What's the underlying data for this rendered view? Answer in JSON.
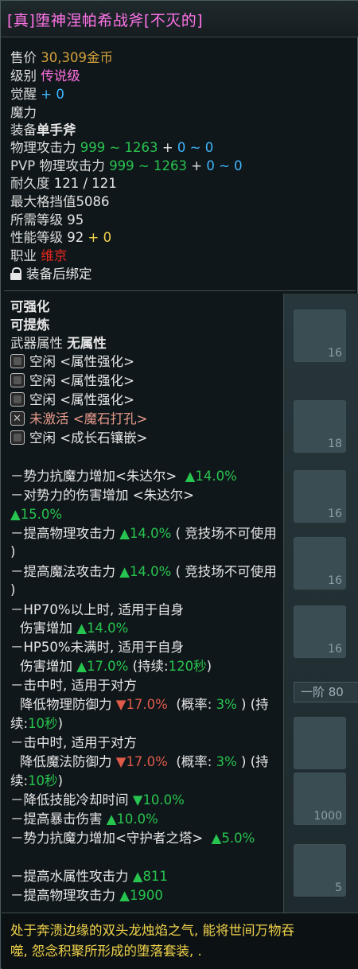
{
  "title": "[真]堕神涅帕希战斧[不灭的]",
  "header": {
    "price_label": "售价",
    "price_value": "30,309金币",
    "grade_label": "级别",
    "grade_value": "传说级",
    "awaken_label": "觉醒",
    "awaken_value": "+ 0",
    "magic_label": "魔力",
    "equip_label": "装备",
    "equip_value": "单手斧",
    "patk_label": "物理攻击力",
    "patk_range": "999 ~ 1263",
    "patk_plus": "+",
    "patk_bonus": "0 ~ 0",
    "pvp_label": "PVP 物理攻击力",
    "pvp_range": "999 ~ 1263",
    "pvp_plus": "+",
    "pvp_bonus": "0 ~ 0",
    "durability_label": "耐久度",
    "durability_value": "121 / 121",
    "block_label": "最大格挡值",
    "block_value": "5086",
    "req_level_label": "所需等级",
    "req_level_value": "95",
    "perf_level_label": "性能等级",
    "perf_level_value": "92",
    "perf_level_bonus": "+ 0",
    "job_label": "职业",
    "job_value": "维京",
    "bind_text": "装备后绑定"
  },
  "enhance": {
    "enhanceable": "可强化",
    "refinable": "可提炼",
    "weapon_attr_label": "武器属性",
    "weapon_attr_value": "无属性"
  },
  "sockets": [
    {
      "status": "空闲",
      "type": "<属性强化>"
    },
    {
      "status": "空闲",
      "type": "<属性强化>"
    },
    {
      "status": "空闲",
      "type": "<属性强化>"
    },
    {
      "status": "未激活",
      "type": "<魔石打孔>"
    },
    {
      "status": "空闲",
      "type": "<成长石镶嵌>"
    }
  ],
  "effects": {
    "e1_text": "－势力抗魔力增加<朱达尔>",
    "e1_val": "▲14.0%",
    "e2_text": "－对势力的伤害增加 <朱达尔>",
    "e2_val": "▲15.0%",
    "e3_text": "－提高物理攻击力",
    "e3_val": "▲14.0%",
    "e3_note": "( 竞技场不可使用",
    "e3_close": ")",
    "e4_text": "－提高魔法攻击力",
    "e4_val": "▲14.0%",
    "e4_note": "( 竞技场不可使用",
    "e4_close": ")",
    "e5_line1": "－HP70%以上时, 适用于自身",
    "e5_line2": "伤害增加",
    "e5_val": "▲14.0%",
    "e6_line1": "－HP50%未满时, 适用于自身",
    "e6_line2": "伤害增加",
    "e6_val": "▲17.0%",
    "e6_dur_pre": "(持续:",
    "e6_dur_val": "120秒",
    "e6_dur_post": ")",
    "e7_line1": "－击中时, 适用于对方",
    "e7_line2": "降低物理防御力",
    "e7_val": "▼17.0%",
    "e7_prob_pre": "(概率:",
    "e7_prob_val": "3%",
    "e7_prob_post": ")  (持",
    "e7_dur_pre": "续:",
    "e7_dur_val": "10秒",
    "e7_dur_post": ")",
    "e8_line1": "－击中时, 适用于对方",
    "e8_line2": "降低魔法防御力",
    "e8_val": "▼17.0%",
    "e8_prob_pre": "(概率:",
    "e8_prob_val": "3%",
    "e8_prob_post": ")  (持",
    "e8_dur_pre": "续:",
    "e8_dur_val": "10秒",
    "e8_dur_post": ")",
    "e9_text": "－降低技能冷却时间",
    "e9_val": "▼10.0%",
    "e10_text": "－提高暴击伤害",
    "e10_val": "▲10.0%",
    "e11_text": "－势力抗魔力增加<守护者之塔>",
    "e11_val": "▲5.0%"
  },
  "extra": {
    "x1_text": "－提高水属性攻击力",
    "x1_val": "▲811",
    "x2_text": "－提高物理攻击力",
    "x2_val": "▲1900"
  },
  "description": {
    "line1": "处于奔溃边缘的双头龙烛焰之气, 能将世间万物吞",
    "line2": "噬, 怨念积聚所形成的堕落套装, ."
  },
  "background": {
    "slot_numbers": [
      "16",
      "18",
      "16",
      "16",
      "16",
      "1000",
      "5"
    ],
    "tab_label": "一阶 80"
  }
}
